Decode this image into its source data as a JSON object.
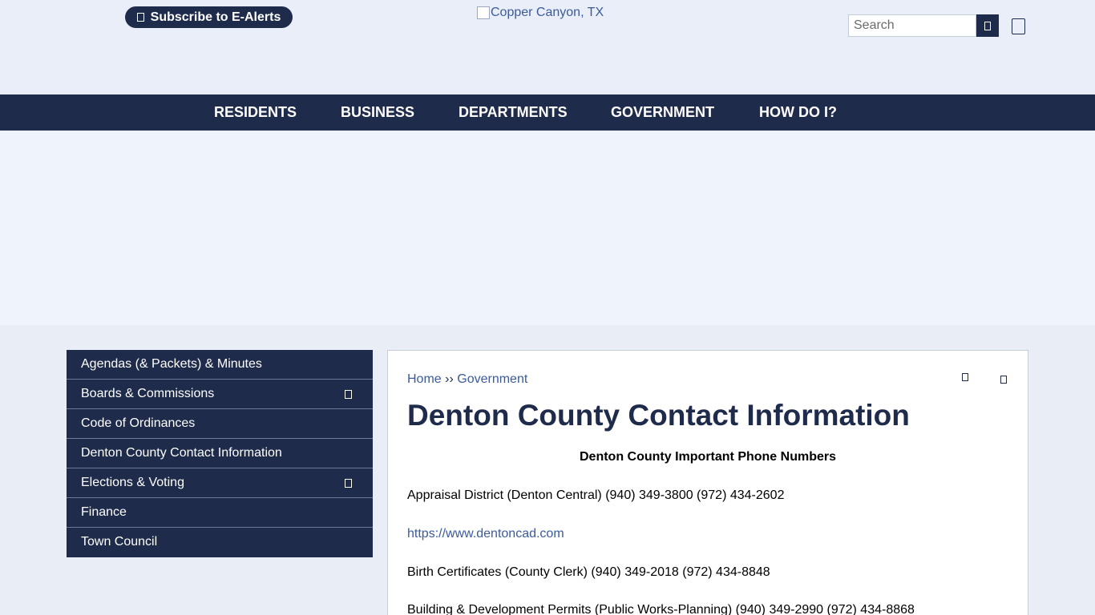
{
  "header": {
    "subscribe_label": "Subscribe to E-Alerts",
    "logo_alt": "Copper Canyon, TX",
    "search_placeholder": "Search"
  },
  "nav": {
    "items": [
      "RESIDENTS",
      "BUSINESS",
      "DEPARTMENTS",
      "GOVERNMENT",
      "HOW DO I?"
    ]
  },
  "sidebar": {
    "items": [
      {
        "label": "Agendas (& Packets) & Minutes"
      },
      {
        "label": "Boards & Commissions"
      },
      {
        "label": "Code of Ordinances"
      },
      {
        "label": "Denton County Contact Information"
      },
      {
        "label": "Elections & Voting"
      },
      {
        "label": "Finance"
      },
      {
        "label": "Town Council"
      }
    ]
  },
  "breadcrumb": {
    "home": "Home",
    "separator": "››",
    "current": "Government"
  },
  "page": {
    "title": "Denton County Contact Information",
    "subheading": "Denton County Important Phone Numbers",
    "lines": [
      "Appraisal District (Denton Central) (940) 349-3800 (972) 434-2602",
      "https://www.dentoncad.com",
      "Birth Certificates (County Clerk) (940) 349-2018 (972) 434-8848",
      "Building & Development Permits (Public Works-Planning) (940) 349-2990 (972) 434-8868"
    ]
  },
  "colors": {
    "navy": "#1f2b4b",
    "link": "#3b5b9a",
    "hero_bg": "#eef3fc"
  }
}
